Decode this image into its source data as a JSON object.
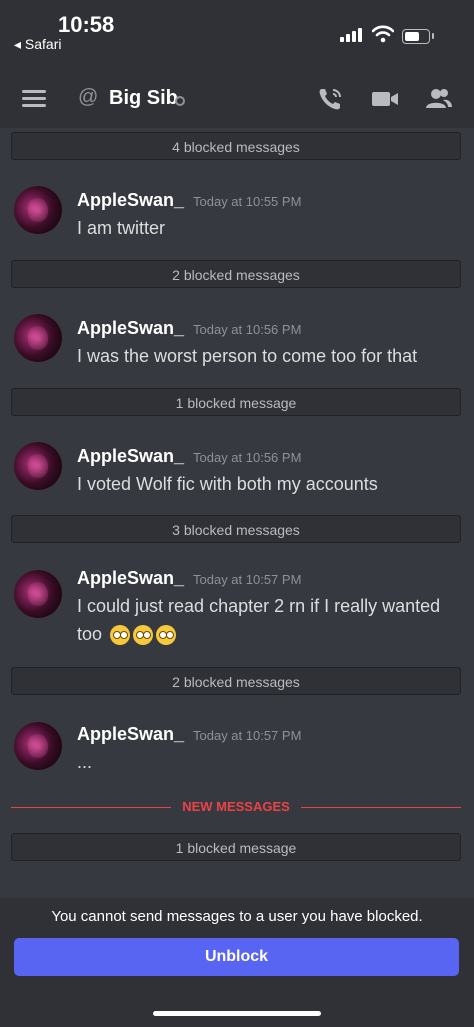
{
  "status_bar": {
    "time": "10:58",
    "back_label": "◂ Safari"
  },
  "header": {
    "channel_prefix": "@",
    "title": "Big Sib"
  },
  "feed": [
    {
      "kind": "blocked",
      "text": "4 blocked messages"
    },
    {
      "kind": "message",
      "author": "AppleSwan_",
      "timestamp": "Today at 10:55 PM",
      "text": "I am twitter"
    },
    {
      "kind": "blocked",
      "text": "2 blocked messages"
    },
    {
      "kind": "message",
      "author": "AppleSwan_",
      "timestamp": "Today at 10:56 PM",
      "text": "I was the worst person to come too for that"
    },
    {
      "kind": "blocked",
      "text": "1 blocked message"
    },
    {
      "kind": "message",
      "author": "AppleSwan_",
      "timestamp": "Today at 10:56 PM",
      "text": "I voted Wolf fic with both my accounts"
    },
    {
      "kind": "blocked",
      "text": "3 blocked messages"
    },
    {
      "kind": "message",
      "author": "AppleSwan_",
      "timestamp": "Today at 10:57 PM",
      "text": "I could just read chapter 2 rn if I really wanted too",
      "emojis": [
        "eye-roll-emoji",
        "eye-roll-emoji",
        "eye-roll-emoji"
      ]
    },
    {
      "kind": "blocked",
      "text": "2 blocked messages"
    },
    {
      "kind": "message",
      "author": "AppleSwan_",
      "timestamp": "Today at 10:57 PM",
      "text": "..."
    },
    {
      "kind": "blocked",
      "text": "1 blocked message"
    }
  ],
  "new_messages_label": "NEW MESSAGES",
  "footer": {
    "notice": "You cannot send messages to a user you have blocked.",
    "unblock_label": "Unblock"
  },
  "colors": {
    "background": "#36393f",
    "header": "#2f3136",
    "accent": "#5865f2",
    "new_messages": "#ed4245"
  }
}
